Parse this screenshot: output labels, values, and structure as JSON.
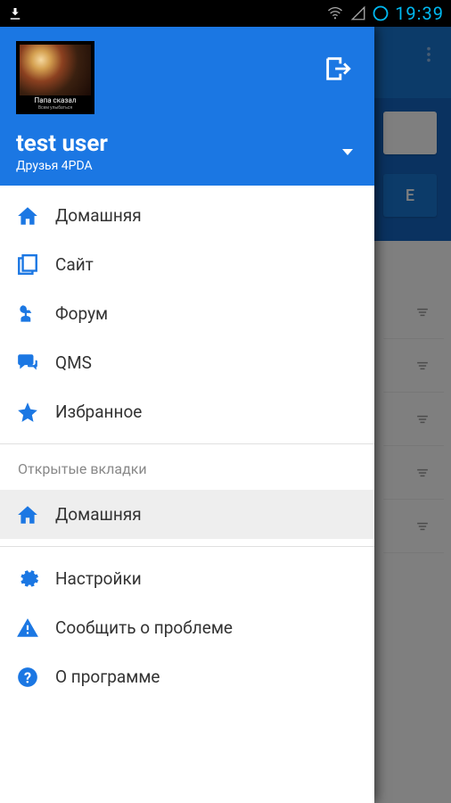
{
  "status": {
    "time": "19:39"
  },
  "drawer": {
    "avatar": {
      "caption": "Папа сказал",
      "sub": "Всем улыбаться"
    },
    "user": {
      "name": "test user",
      "group": "Друзья 4PDA"
    },
    "menu": [
      {
        "id": "home",
        "icon": "home",
        "label": "Домашняя"
      },
      {
        "id": "site",
        "icon": "site",
        "label": "Сайт"
      },
      {
        "id": "forum",
        "icon": "forum",
        "label": "Форум"
      },
      {
        "id": "qms",
        "icon": "qms",
        "label": "QMS"
      },
      {
        "id": "fav",
        "icon": "star",
        "label": "Избранное"
      }
    ],
    "section_open_tabs": "Открытые вкладки",
    "open_tabs": [
      {
        "id": "home",
        "icon": "home",
        "label": "Домашняя",
        "active": true
      }
    ],
    "footer": [
      {
        "id": "settings",
        "icon": "gear",
        "label": "Настройки"
      },
      {
        "id": "report",
        "icon": "warn",
        "label": "Сообщить о проблеме"
      },
      {
        "id": "about",
        "icon": "help",
        "label": "О программе"
      }
    ]
  },
  "background": {
    "button_letter": "E"
  }
}
